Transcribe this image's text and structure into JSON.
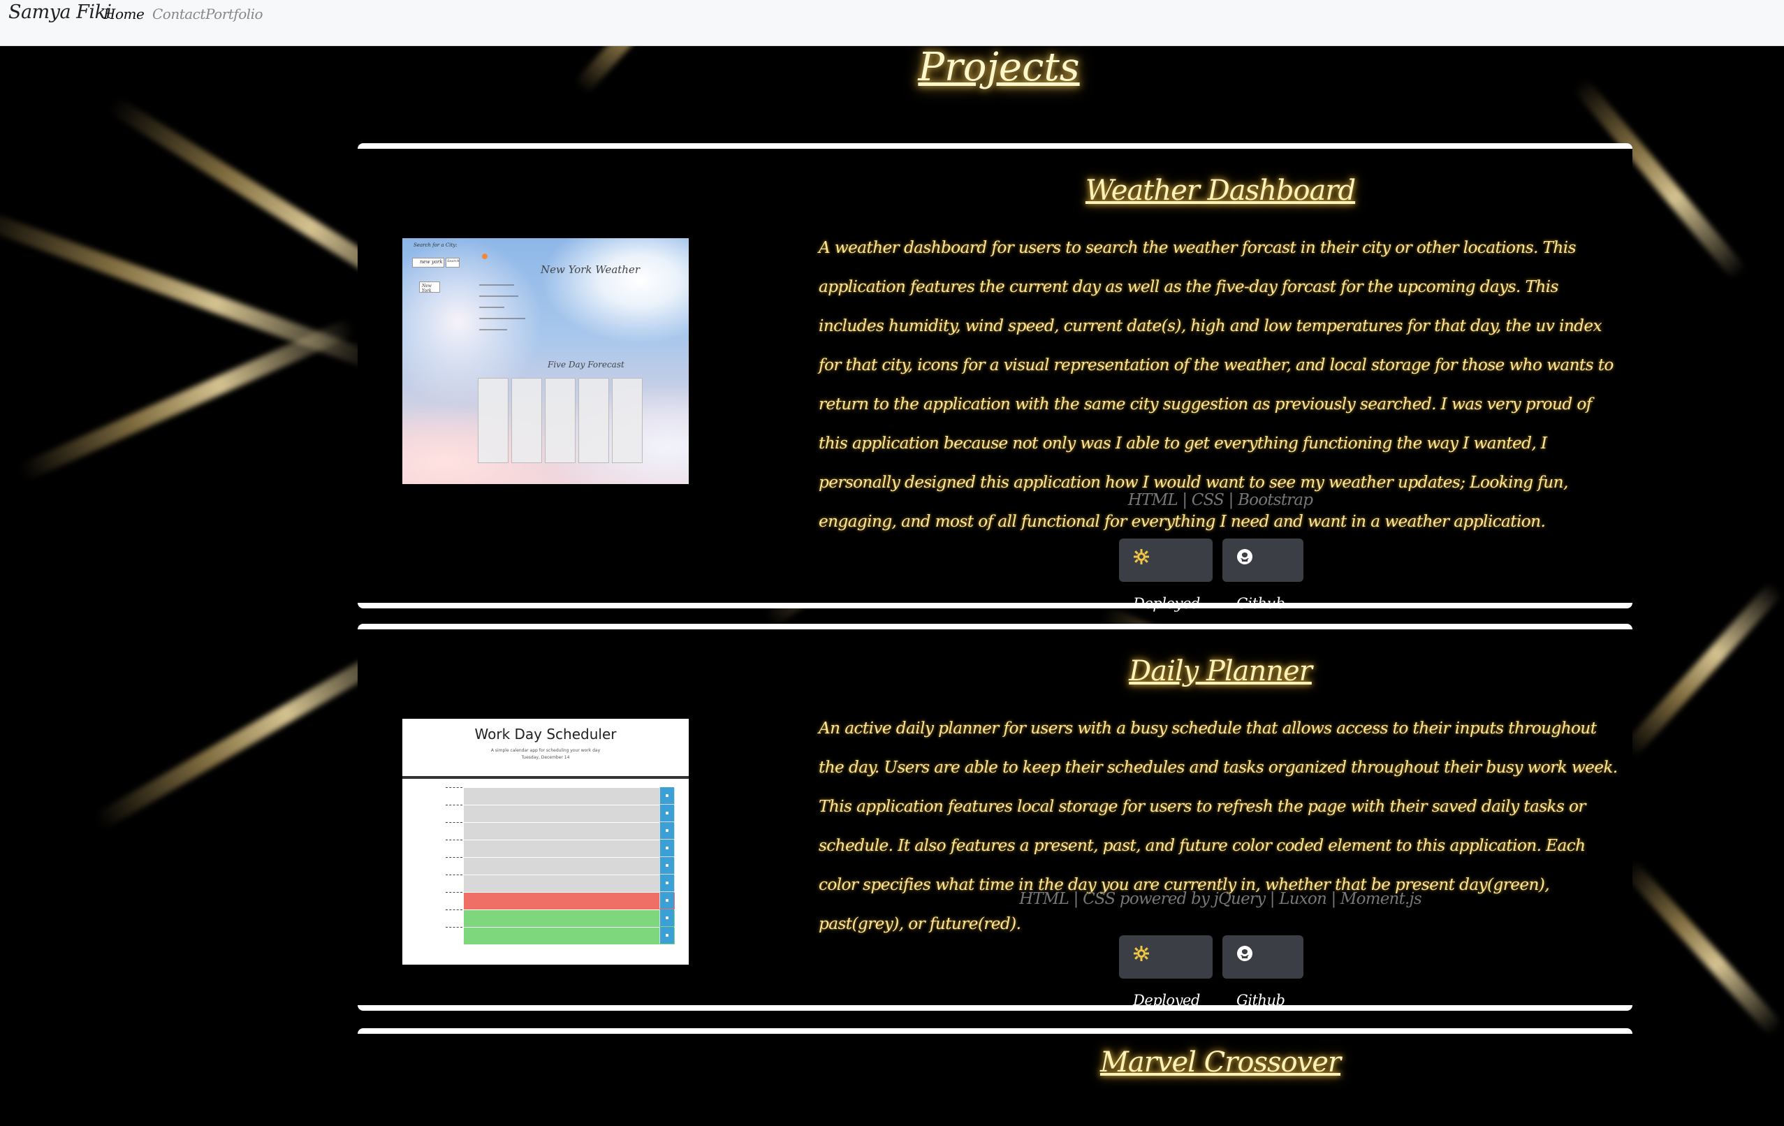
{
  "navbar": {
    "brand": "Samya Fiki",
    "links": [
      {
        "label": "Home",
        "active": true
      },
      {
        "label": "Contact",
        "active": false
      },
      {
        "label": "Portfolio",
        "active": false
      }
    ]
  },
  "page_title": "Projects",
  "projects": [
    {
      "title": "Weather Dashboard",
      "description": "A weather dashboard for users to search the weather forcast in their city or other locations. This application features the current day as well as the five-day forcast for the upcoming days. This includes humidity, wind speed, current date(s), high and low temperatures for that day, the uv index for that city, icons for a visual representation of the weather, and local storage for those who wants to return to the application with the same city suggestion as previously searched. I was very proud of this application because not only was I able to get everything functioning the way I wanted, I personally designed this application how I would want to see my weather updates; Looking fun, engaging, and most of all functional for everything I need and want in a weather application.",
      "tech": "HTML | CSS | Bootstrap",
      "buttons": {
        "deployed": "Deployed",
        "github": "Github"
      },
      "screenshot": {
        "search_label": "Search for a City:",
        "search_value": "new york",
        "search_button": "Search",
        "history_item": "New York",
        "city_heading": "New York Weather",
        "forecast_heading": "Five Day Forecast"
      }
    },
    {
      "title": "Daily Planner",
      "description": "An active daily planner for users with a busy schedule that allows access to their inputs throughout the day. Users are able to keep their schedules and tasks organized throughout their busy work week. This application features local storage for users to refresh the page with their saved daily tasks or schedule. It also features a present, past, and future color coded element to this application. Each color specifies what time in the day you are currently in, whether that be present day(green), past(grey), or future(red).",
      "tech": "HTML | CSS powered by jQuery | Luxon | Moment.js",
      "buttons": {
        "deployed": "Deployed",
        "github": "Github"
      },
      "screenshot": {
        "title": "Work Day Scheduler",
        "subtitle": "A simple calendar app for scheduling your work day",
        "date": "Tuesday, December 14",
        "rows": [
          {
            "status": "past"
          },
          {
            "status": "past"
          },
          {
            "status": "past"
          },
          {
            "status": "past"
          },
          {
            "status": "past"
          },
          {
            "status": "past"
          },
          {
            "status": "present"
          },
          {
            "status": "future"
          },
          {
            "status": "future"
          }
        ]
      }
    },
    {
      "title": "Marvel Crossover"
    }
  ],
  "colors": {
    "navbar_bg": "#f7f8fa",
    "title_glow": "#e8c45a",
    "description_text": "#ffe699",
    "tech_text": "#777777",
    "button_bg": "#3b3f45",
    "sched_present": "#ef6f66",
    "sched_future": "#7ed67d",
    "sched_past": "#d8d8d8",
    "sched_save": "#3aa0d6"
  },
  "icons": {
    "deployed": "gear-icon",
    "github": "github-icon"
  }
}
